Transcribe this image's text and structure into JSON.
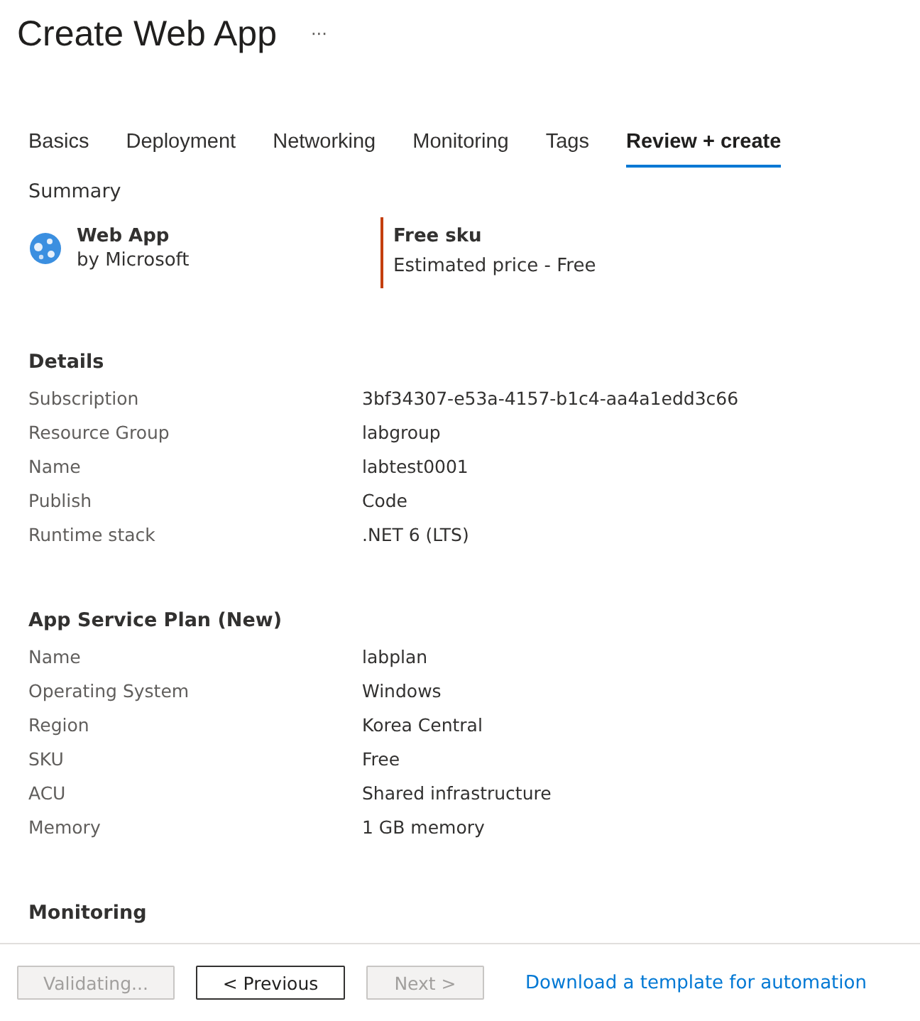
{
  "window": {
    "title": "Create Web App",
    "more": "···"
  },
  "tabs": [
    {
      "label": "Basics",
      "selected": false
    },
    {
      "label": "Deployment",
      "selected": false
    },
    {
      "label": "Networking",
      "selected": false
    },
    {
      "label": "Monitoring",
      "selected": false
    },
    {
      "label": "Tags",
      "selected": false
    },
    {
      "label": "Review + create",
      "selected": true
    }
  ],
  "summary": {
    "heading": "Summary",
    "product": {
      "name": "Web App",
      "publisher": "by Microsoft"
    },
    "sku": {
      "name": "Free sku",
      "price": "Estimated price - Free"
    }
  },
  "sections": [
    {
      "heading": "Details",
      "rows": [
        {
          "label": "Subscription",
          "value": "3bf34307-e53a-4157-b1c4-aa4a1edd3c66"
        },
        {
          "label": "Resource Group",
          "value": "labgroup"
        },
        {
          "label": "Name",
          "value": "labtest0001"
        },
        {
          "label": "Publish",
          "value": "Code"
        },
        {
          "label": "Runtime stack",
          "value": ".NET 6 (LTS)"
        }
      ]
    },
    {
      "heading": "App Service Plan (New)",
      "rows": [
        {
          "label": "Name",
          "value": "labplan"
        },
        {
          "label": "Operating System",
          "value": "Windows"
        },
        {
          "label": "Region",
          "value": "Korea Central"
        },
        {
          "label": "SKU",
          "value": "Free"
        },
        {
          "label": "ACU",
          "value": "Shared infrastructure"
        },
        {
          "label": "Memory",
          "value": "1 GB memory"
        }
      ]
    },
    {
      "heading": "Monitoring"
    }
  ],
  "footer": {
    "buttons": [
      {
        "label": "Validating...",
        "disabled": true
      },
      {
        "label": "< Previous",
        "disabled": false
      },
      {
        "label": "Next >",
        "disabled": true
      }
    ],
    "link": "Download a template for automation"
  }
}
